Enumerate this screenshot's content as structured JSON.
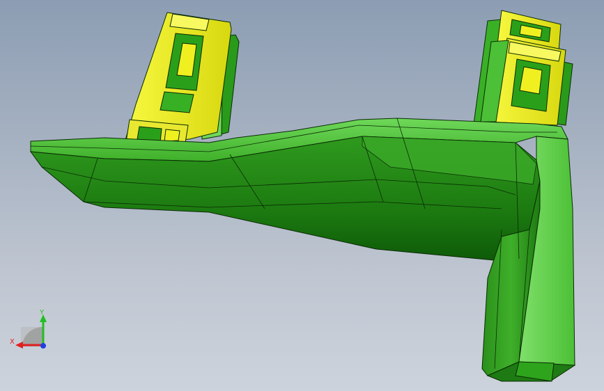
{
  "viewport": {
    "background_top": "#8c9db3",
    "background_bottom": "#cdd3dc"
  },
  "model": {
    "body_color": "#2e9a1e",
    "body_dark": "#0e5a08",
    "body_light": "#6fd85a",
    "clip_color": "#f0f020",
    "edge_color": "#0a2a05"
  },
  "triad": {
    "x_label": "X",
    "y_label": "Y",
    "x_color": "#e02020",
    "y_color": "#20c020",
    "z_color": "#2040e0"
  }
}
